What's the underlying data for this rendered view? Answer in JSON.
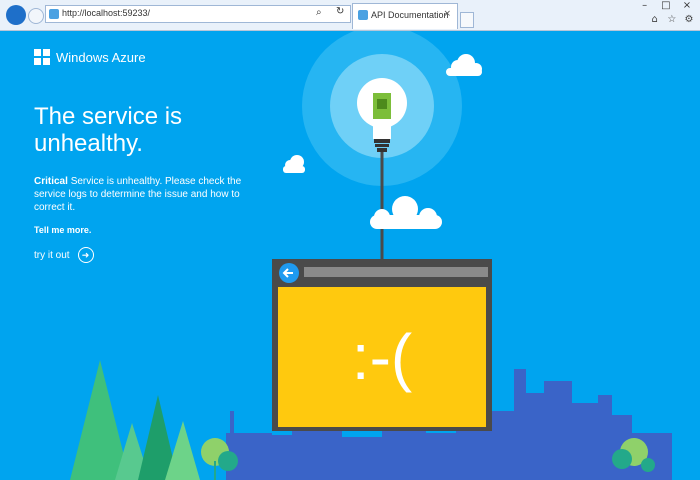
{
  "browser": {
    "url": "http://localhost:59233/",
    "tab_title": "API Documentation",
    "tab_close": "×",
    "window_controls": [
      "–",
      "□",
      "×"
    ],
    "tool_icons": [
      "home-icon",
      "star-icon",
      "gear-icon"
    ]
  },
  "page": {
    "logo_text": "Windows Azure",
    "headline": "The service is unhealthy.",
    "status_word": "Critical",
    "status_text": "Service is unhealthy. Please check the service logs to determine the issue and how to correct it.",
    "tell_more": "Tell me more.",
    "try_label": "try it out",
    "sad_face": ":-("
  },
  "colors": {
    "background": "#00a4ef",
    "sad_screen": "#ffc90e",
    "window_frame": "#4a4a4a"
  }
}
